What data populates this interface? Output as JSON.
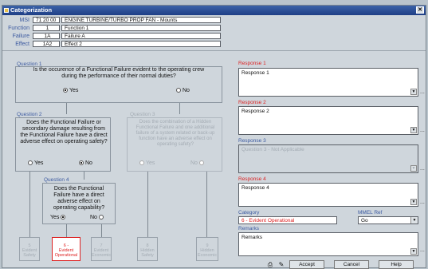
{
  "window": {
    "title": "Categorization"
  },
  "header": {
    "msi": {
      "label": "MSI",
      "code": "71 20 00",
      "desc": "ENGINE TURBINE/TURBO PROP FAN - Mounts"
    },
    "function": {
      "label": "Function",
      "code": "1",
      "desc": "Function 1"
    },
    "failure": {
      "label": "Failure",
      "code": "1A",
      "desc": "Failure A"
    },
    "effect": {
      "label": "Effect",
      "code": "1A2",
      "desc": "Effect 2"
    }
  },
  "q1": {
    "title": "Question 1",
    "text": "Is the occurence of a Functional Failure evident to the operating crew during the performance of their normal duties?",
    "yes": "Yes",
    "no": "No"
  },
  "q2": {
    "title": "Question 2",
    "text": "Does the Functional Failure or secondary damage resulting from the Functional Failure have a direct adverse effect on operating safety?",
    "yes": "Yes",
    "no": "No"
  },
  "q3": {
    "title": "Question 3",
    "text": "Does the combination of a Hidden Functional Failure and one additional failure of a system related or back-up function have an adverse effect on operating safety?",
    "yes": "Yes",
    "no": "No"
  },
  "q4": {
    "title": "Question 4",
    "text": "Does the Functional Failure have a direct adverse effect on operating capability?",
    "yes": "Yes",
    "no": "No"
  },
  "terms": {
    "t1": "5\nEvident\nSafety",
    "t2": "6 -\nEvident\nOperational",
    "t3": "7\nEvident\nEconomic",
    "t4": "8\nHidden\nSafety",
    "t5": "9\nHidden\nEconomic"
  },
  "responses": {
    "r1": {
      "label": "Response 1",
      "value": "Response 1"
    },
    "r2": {
      "label": "Response 2",
      "value": "Response 2"
    },
    "r3": {
      "label": "Response 3",
      "value": "Question 3 - Not Applicable"
    },
    "r4": {
      "label": "Response 4",
      "value": "Response 4"
    }
  },
  "category": {
    "label": "Category",
    "value": "6 - Evident Operational"
  },
  "mmel": {
    "label": "MMEL Ref",
    "value": "Go"
  },
  "remarks": {
    "label": "Remarks",
    "value": "Remarks"
  },
  "buttons": {
    "accept": "Accept",
    "cancel": "Cancel",
    "help": "Help"
  },
  "colors": {
    "title_bar": "#1f3f86",
    "accent_red": "#dd2222",
    "label_blue": "#3c5aa0"
  }
}
